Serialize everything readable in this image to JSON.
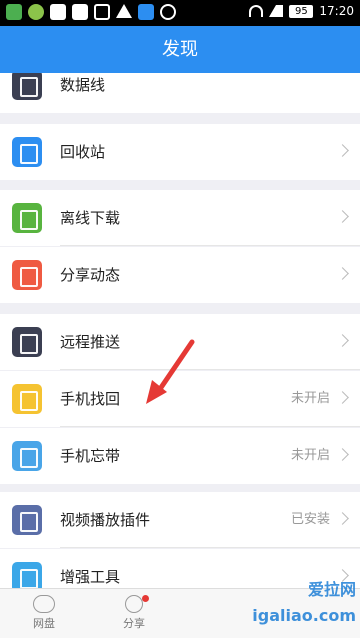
{
  "status_bar": {
    "battery": "95",
    "time": "17:20"
  },
  "header": {
    "title": "发现"
  },
  "rows": [
    {
      "label": "数据线",
      "status": "",
      "icon": "data-cable-icon",
      "color": "#3b3f52"
    },
    {
      "label": "回收站",
      "status": "",
      "icon": "recycle-bin-icon",
      "color": "#2c8ef1"
    },
    {
      "label": "离线下载",
      "status": "",
      "icon": "offline-download-icon",
      "color": "#58b43f"
    },
    {
      "label": "分享动态",
      "status": "",
      "icon": "share-feed-icon",
      "color": "#ef5a42"
    },
    {
      "label": "远程推送",
      "status": "",
      "icon": "remote-push-icon",
      "color": "#3b3f52"
    },
    {
      "label": "手机找回",
      "status": "未开启",
      "icon": "find-phone-icon",
      "color": "#f5c331"
    },
    {
      "label": "手机忘带",
      "status": "未开启",
      "icon": "forgot-phone-icon",
      "color": "#49a5e8"
    },
    {
      "label": "视频播放插件",
      "status": "已安装",
      "icon": "video-plugin-icon",
      "color": "#5a6ea8"
    },
    {
      "label": "增强工具",
      "status": "",
      "icon": "toolbox-icon",
      "color": "#3ba7e8"
    }
  ],
  "tabbar": {
    "tabs": [
      {
        "label": "网盘",
        "icon": "cloud-icon"
      },
      {
        "label": "分享",
        "icon": "share-icon"
      }
    ]
  },
  "watermark": "爱拉网 igaliao.com"
}
